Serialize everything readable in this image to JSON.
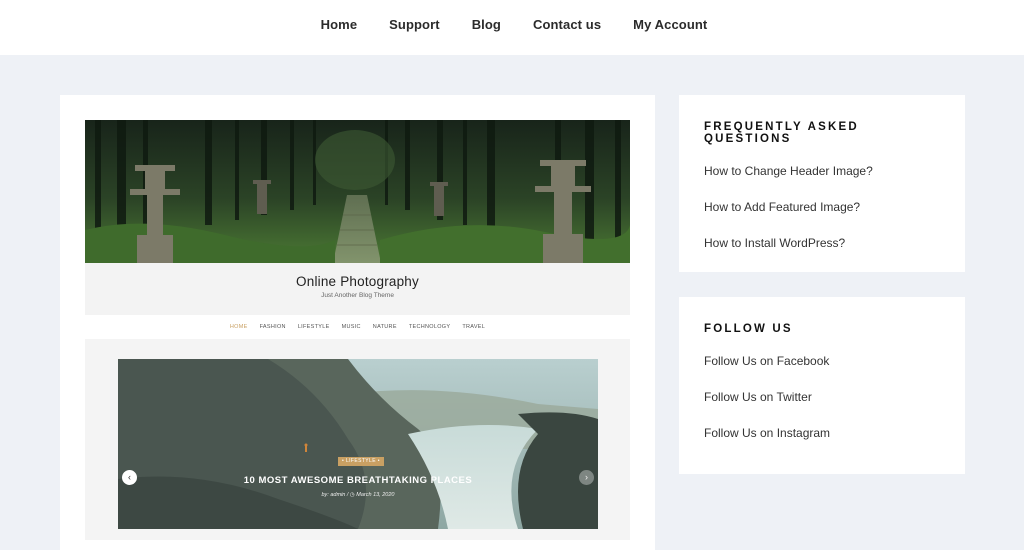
{
  "topnav": {
    "items": [
      "Home",
      "Support",
      "Blog",
      "Contact us",
      "My Account"
    ]
  },
  "preview": {
    "site_title": "Online Photography",
    "tagline": "Just Another Blog Theme",
    "nav": [
      "HOME",
      "FASHION",
      "LIFESTYLE",
      "MUSIC",
      "NATURE",
      "TECHNOLOGY",
      "TRAVEL"
    ],
    "slide": {
      "category": "• LIFESTYLE •",
      "title": "10 MOST AWESOME BREATHTAKING PLACES",
      "meta": "by: admin  /  ◷  March 13, 2020"
    },
    "arrows": {
      "prev": "‹",
      "next": "›"
    }
  },
  "faq": {
    "title": "FREQUENTLY ASKED QUESTIONS",
    "links": [
      "How to Change Header Image?",
      "How to Add Featured Image?",
      "How to Install WordPress?"
    ]
  },
  "follow": {
    "title": "FOLLOW US",
    "links": [
      "Follow Us on Facebook",
      "Follow Us on Twitter",
      "Follow Us on Instagram"
    ]
  },
  "colors": {
    "page_bg": "#eef1f6",
    "accent": "#c9a063"
  },
  "icons": [
    "chevron-left-icon",
    "chevron-right-icon"
  ]
}
